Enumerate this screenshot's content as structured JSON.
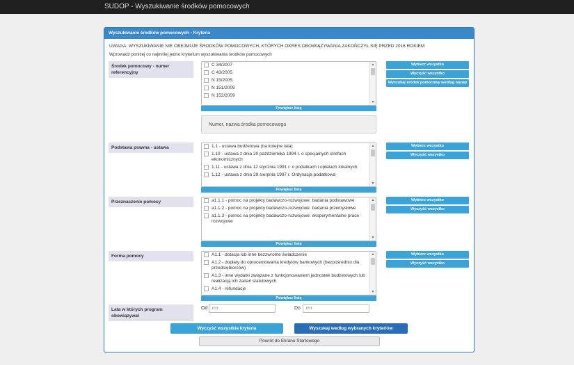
{
  "app": {
    "title": "SUDOP - Wyszukiwanie środków pomocowych"
  },
  "panel": {
    "heading": "Wyszukiwanie środków pomocowych - Kryteria",
    "notice": "UWAGA: WYSZUKIWANIE NIE OBEJMUJE ŚRODKÓW POMOCOWYCH, KTÓRYCH OKRES OBOWIĄZYWANIA ZAKOŃCZYŁ SIĘ PRZED 2016 ROKIEM",
    "hint": "Wprowadź poniżej co najmniej jedno kryterium wyszukiwania środków pomocowych"
  },
  "expand_label": "Powiększ listę",
  "sections": {
    "ref": {
      "label": "Środek pomocowy - numer referencyjny",
      "items": [
        "C 34/2007",
        "C 43/2005",
        "N 15/2005",
        "N 151/2009",
        "N 152/2009"
      ],
      "select_all": "Wybierz wszystko",
      "clear": "Wyczyść wszystko",
      "search_by_name": "Wyszukaj środek pomocowy według nazwy",
      "search_placeholder": "Numer, nazwa środka pomocowego"
    },
    "legal": {
      "label": "Podstawa prawna - ustawa",
      "items": [
        "1.1 - ustawa budżetowa (na kolejne lata)",
        "1.10 - ustawa z dnia 20 października 1994 r. o specjalnych strefach ekonomicznych",
        "1.11 - ustawa z dnia 12 stycznia 1991 r. o podatkach i opłatach lokalnych",
        "1.12 - ustawa z dnia 29 sierpnia 1997 r. Ordynacja podatkowa"
      ],
      "select_all": "Wybierz wszystko",
      "clear": "Wyczyść wszystko"
    },
    "purpose": {
      "label": "Przeznaczenie pomocy",
      "items": [
        "a1.1.1 - pomoc na projekty badawczo-rozwojowe: badania podstawowe",
        "a1.1.2 - pomoc na projekty badawczo-rozwojowe: badania przemysłowe",
        "a1.1.3 - pomoc na projekty badawczo-rozwojowe: eksperymentalne prace rozwojowe"
      ],
      "select_all": "Wybierz wszystko",
      "clear": "Wyczyść wszystko"
    },
    "form": {
      "label": "Forma pomocy",
      "items": [
        "A1.1 - dotacja lub inne bezzwrotne świadczenie",
        "A1.2 - dopłaty do oprocentowania kredytów bankowych (bezpośrednio dla przedsiębiorców)",
        "A1.3 - inne wydatki związane z funkcjonowaniem jednostek budżetowych lub realizacją ich zadań statutowych",
        "A1.4 - refundacje"
      ],
      "select_all": "Wybierz wszystko",
      "clear": "Wyczyść wszystko"
    },
    "years": {
      "label": "Lata w których program obowiązywał",
      "from_label": "Od",
      "to_label": "Do",
      "from_placeholder": "rrrr",
      "to_placeholder": "rrrr"
    }
  },
  "actions": {
    "clear_all": "Wyczyść wszystkie kryteria",
    "search": "Wyszukaj według wybranych kryteriów",
    "back": "Powrót do Ekranu Startowego"
  },
  "colors": {
    "topbar": "#1f1f1f",
    "panel_border": "#337ab7",
    "accent": "#3aa3d8",
    "primary": "#2a6db8"
  }
}
